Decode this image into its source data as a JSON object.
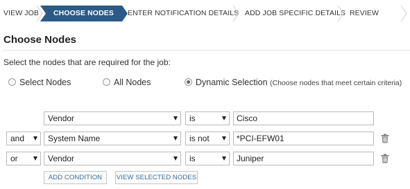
{
  "wizard": {
    "steps": [
      "VIEW JOB",
      "CHOOSE NODES",
      "ENTER NOTIFICATION DETAILS",
      "ADD JOB SPECIFIC DETAILS",
      "REVIEW"
    ],
    "active_index": 1
  },
  "page": {
    "title": "Choose Nodes",
    "instructions": "Select the nodes that are required for the job:"
  },
  "selection_mode": {
    "options": [
      {
        "label": "Select Nodes",
        "checked": false
      },
      {
        "label": "All Nodes",
        "checked": false
      },
      {
        "label": "Dynamic Selection",
        "hint": "(Choose nodes that meet certain criteria)",
        "checked": true
      }
    ]
  },
  "conditions": [
    {
      "join": "",
      "field": "Vendor",
      "operator": "is",
      "value": "Cisco"
    },
    {
      "join": "and",
      "field": "System Name",
      "operator": "is not",
      "value": "*PCI-EFW01"
    },
    {
      "join": "or",
      "field": "Vendor",
      "operator": "is",
      "value": "Juniper"
    }
  ],
  "buttons": {
    "add_condition": "ADD CONDITION",
    "view_selected": "VIEW SELECTED NODES"
  },
  "colors": {
    "active_step": "#2b5a86",
    "link_text": "#336e99"
  }
}
